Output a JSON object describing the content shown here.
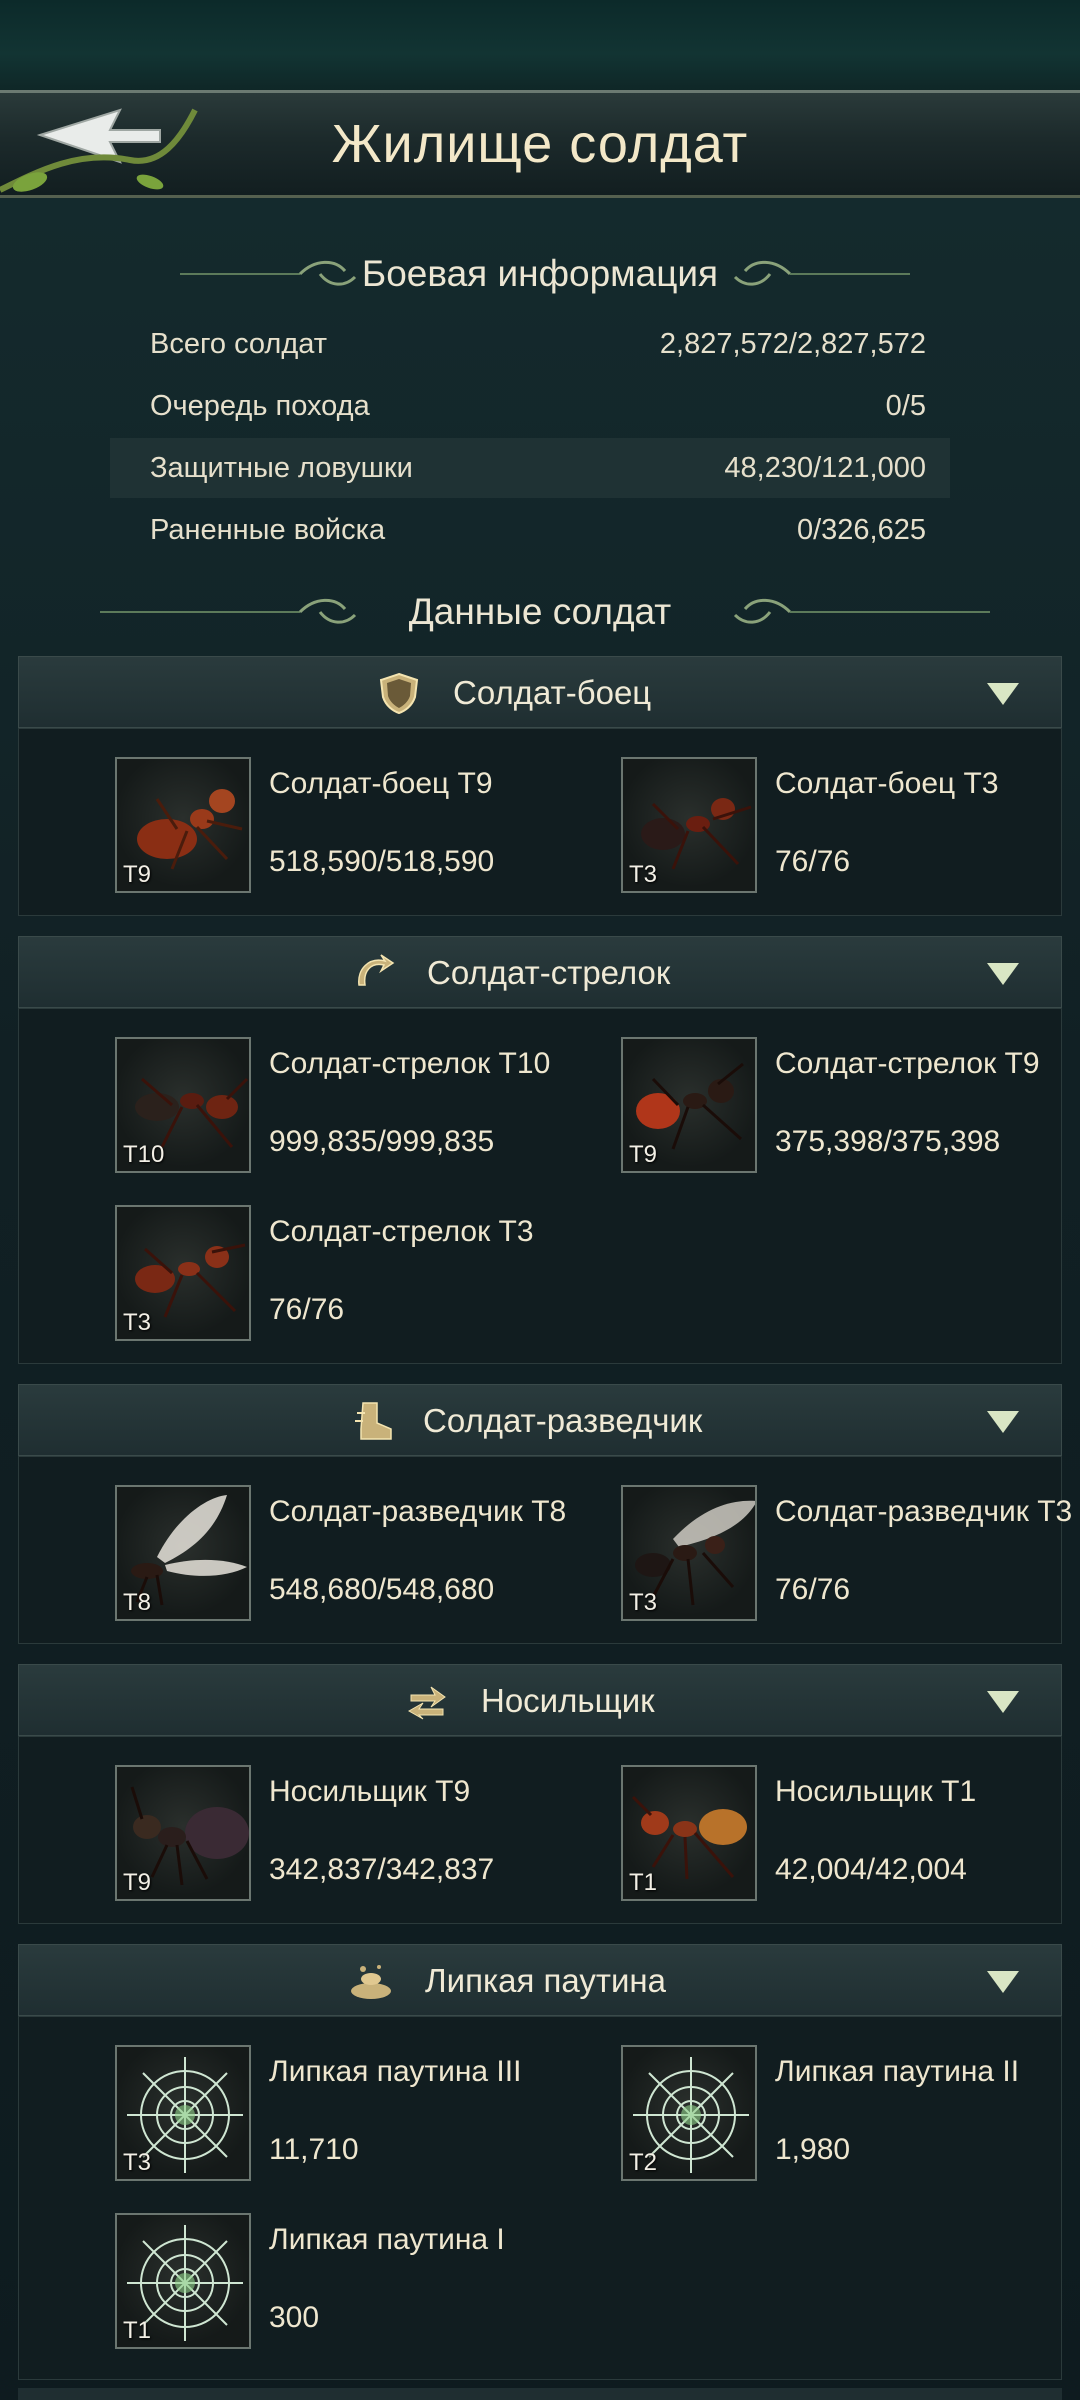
{
  "header": {
    "title": "Жилище солдат"
  },
  "battle_info": {
    "heading": "Боевая информация",
    "rows": [
      {
        "label": "Всего солдат",
        "value": "2,827,572/2,827,572"
      },
      {
        "label": "Очередь похода",
        "value": "0/5"
      },
      {
        "label": "Защитные ловушки",
        "value": "48,230/121,000"
      },
      {
        "label": "Раненные войска",
        "value": "0/326,625"
      }
    ]
  },
  "soldier_data": {
    "heading": "Данные солдат",
    "categories": [
      {
        "title": "Солдат-боец",
        "icon": "shield-icon",
        "units": [
          {
            "name": "Солдат-боец T9",
            "count": "518,590/518,590",
            "tier": "T9"
          },
          {
            "name": "Солдат-боец T3",
            "count": "76/76",
            "tier": "T3"
          }
        ]
      },
      {
        "title": "Солдат-стрелок",
        "icon": "curved-arrow-icon",
        "units": [
          {
            "name": "Солдат-стрелок T10",
            "count": "999,835/999,835",
            "tier": "T10"
          },
          {
            "name": "Солдат-стрелок T9",
            "count": "375,398/375,398",
            "tier": "T9"
          },
          {
            "name": "Солдат-стрелок T3",
            "count": "76/76",
            "tier": "T3"
          }
        ]
      },
      {
        "title": "Солдат-разведчик",
        "icon": "boot-icon",
        "units": [
          {
            "name": "Солдат-разведчик T8",
            "count": "548,680/548,680",
            "tier": "T8"
          },
          {
            "name": "Солдат-разведчик T3",
            "count": "76/76",
            "tier": "T3"
          }
        ]
      },
      {
        "title": "Носильщик",
        "icon": "swap-arrows-icon",
        "units": [
          {
            "name": "Носильщик T9",
            "count": "342,837/342,837",
            "tier": "T9"
          },
          {
            "name": "Носильщик T1",
            "count": "42,004/42,004",
            "tier": "T1"
          }
        ]
      },
      {
        "title": "Липкая паутина",
        "icon": "web-trap-icon",
        "units": [
          {
            "name": "Липкая паутина III",
            "count": "11,710",
            "tier": "T3"
          },
          {
            "name": "Липкая паутина II",
            "count": "1,980",
            "tier": "T2"
          },
          {
            "name": "Липкая паутина I",
            "count": "300",
            "tier": "T1"
          }
        ]
      }
    ]
  },
  "colors": {
    "background": "#0f1c20",
    "header_text": "#f3e8c8",
    "accent_chevron": "#d9e6c4"
  }
}
